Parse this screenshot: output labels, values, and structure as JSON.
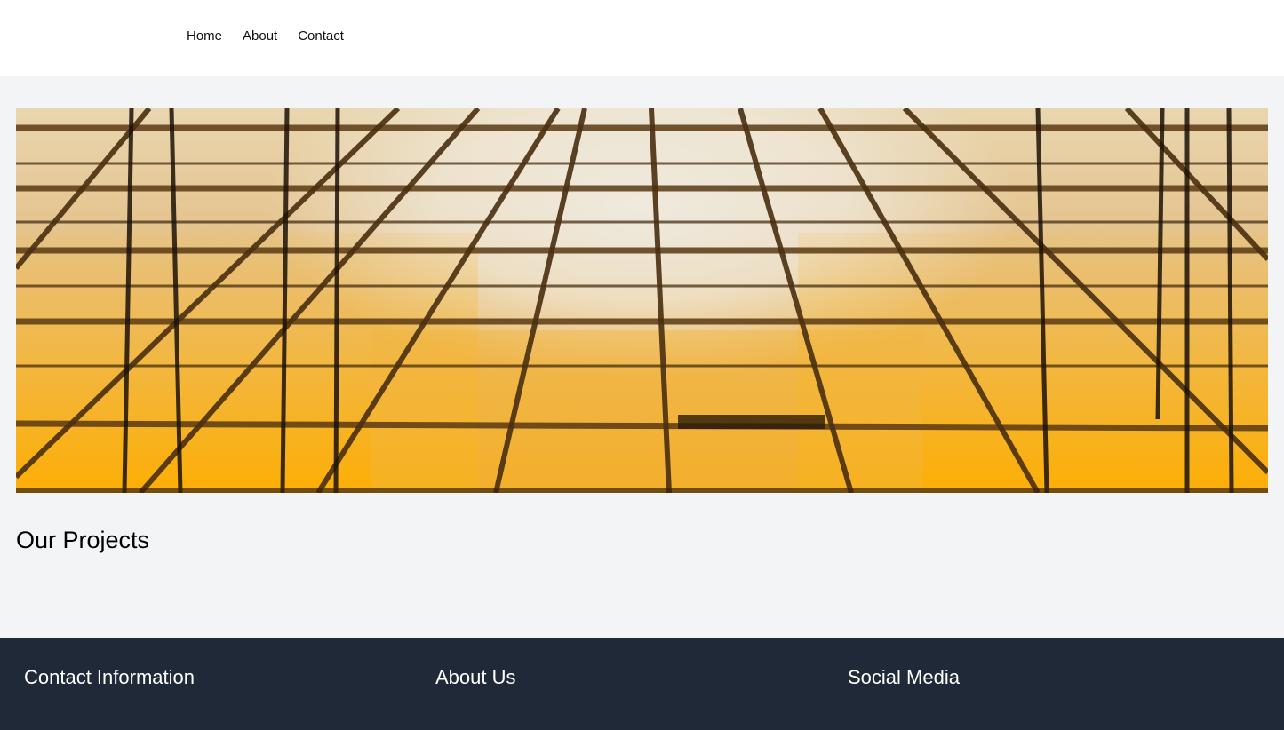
{
  "header": {
    "nav": [
      {
        "label": "Home"
      },
      {
        "label": "About"
      },
      {
        "label": "Contact"
      }
    ]
  },
  "hero": {
    "image_description": "Golden glass building facade viewed from below"
  },
  "main": {
    "section_title": "Our Projects"
  },
  "footer": {
    "columns": [
      {
        "title": "Contact Information"
      },
      {
        "title": "About Us"
      },
      {
        "title": "Social Media"
      }
    ]
  },
  "colors": {
    "page_background": "#f3f4f6",
    "header_background": "#ffffff",
    "footer_background": "#1f2937",
    "footer_text": "#ffffff"
  }
}
